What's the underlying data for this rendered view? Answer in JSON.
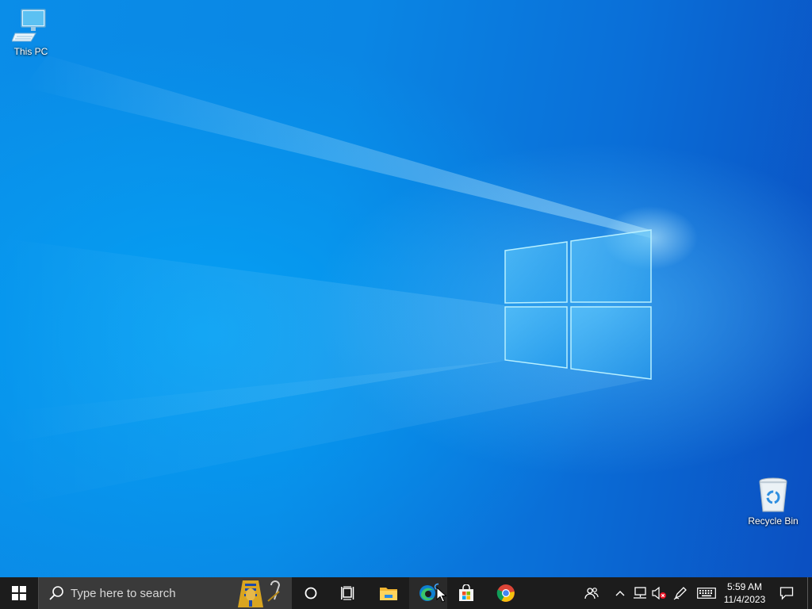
{
  "desktop": {
    "icons": [
      {
        "label": "This PC",
        "icon": "computer-icon"
      },
      {
        "label": "Recycle Bin",
        "icon": "recycle-bin-icon"
      }
    ],
    "wallpaper": {
      "accent": "#0a86e4",
      "light": "#8fe0ff"
    }
  },
  "taskbar": {
    "background": "#1c1c1c",
    "start_icon": "windows-logo-icon",
    "search": {
      "placeholder": "Type here to search"
    },
    "pinned_apps": [
      {
        "name": "Cortana",
        "icon": "cortana-circle-icon"
      },
      {
        "name": "Task View",
        "icon": "task-view-icon"
      },
      {
        "name": "File Explorer",
        "icon": "folder-icon"
      },
      {
        "name": "Microsoft Edge",
        "icon": "edge-icon"
      },
      {
        "name": "Microsoft Store",
        "icon": "store-bag-icon"
      },
      {
        "name": "Google Chrome",
        "icon": "chrome-icon"
      }
    ],
    "tray": {
      "icons": [
        "people-icon",
        "chevron-up-icon",
        "network-icon",
        "volume-muted-icon",
        "pen-icon",
        "keyboard-icon"
      ],
      "time": "5:59 AM",
      "date": "11/4/2023",
      "notification_icon": "action-center-icon"
    }
  }
}
